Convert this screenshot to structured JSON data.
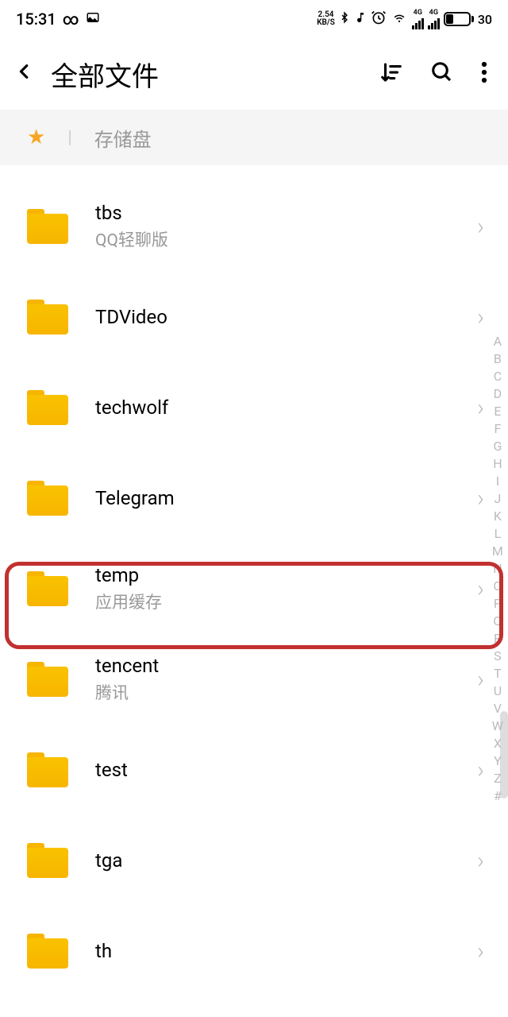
{
  "statusBar": {
    "time": "15:31",
    "speed_top": "2.54",
    "speed_bottom": "KB/S",
    "net1": "4G",
    "net2": "4G",
    "battery": "30"
  },
  "header": {
    "title": "全部文件"
  },
  "breadcrumb": {
    "label": "存储盘"
  },
  "folders": [
    {
      "name": "tbs",
      "sub": "QQ轻聊版"
    },
    {
      "name": "TDVideo",
      "sub": ""
    },
    {
      "name": "techwolf",
      "sub": ""
    },
    {
      "name": "Telegram",
      "sub": ""
    },
    {
      "name": "temp",
      "sub": "应用缓存"
    },
    {
      "name": "tencent",
      "sub": "腾讯"
    },
    {
      "name": "test",
      "sub": ""
    },
    {
      "name": "tga",
      "sub": ""
    },
    {
      "name": "th",
      "sub": ""
    }
  ],
  "index": [
    "A",
    "B",
    "C",
    "D",
    "E",
    "F",
    "G",
    "H",
    "I",
    "J",
    "K",
    "L",
    "M",
    "N",
    "O",
    "P",
    "Q",
    "R",
    "S",
    "T",
    "U",
    "V",
    "W",
    "X",
    "Y",
    "Z",
    "#"
  ]
}
